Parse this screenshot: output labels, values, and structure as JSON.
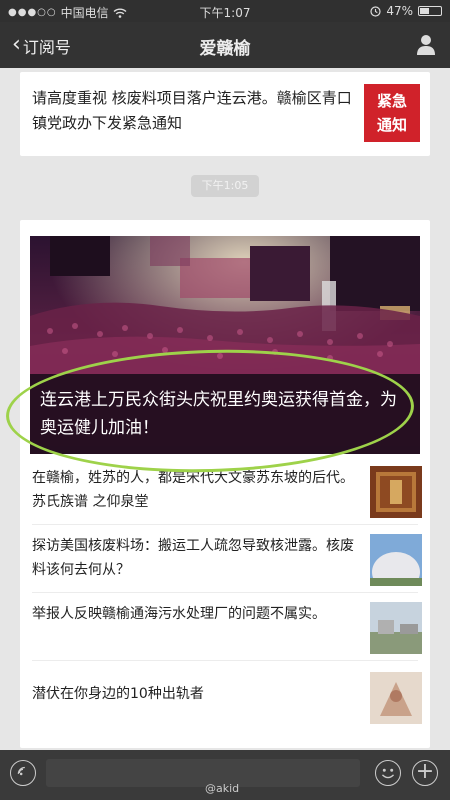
{
  "status_bar": {
    "carrier": "中国电信",
    "time": "下午1:07",
    "battery": "47%",
    "battery_level": 0.47
  },
  "nav": {
    "back_label": "订阅号",
    "title": "爱赣榆"
  },
  "article_top": {
    "text": "请高度重视 核废料项目落户连云港。赣榆区青口镇党政办下发紧急通知",
    "badge_line1": "紧急",
    "badge_line2": "通知"
  },
  "timestamp": "下午1:05",
  "feature": {
    "caption": "连云港上万民众街头庆祝里约奥运获得首金，为奥运健儿加油！"
  },
  "items": [
    {
      "title": "在赣榆，姓苏的人，都是宋代大文豪苏东坡的后代。苏氏族谱 之仰泉堂"
    },
    {
      "title": "探访美国核废料场：搬运工人疏忽导致核泄露。核废料该何去何从？"
    },
    {
      "title": "举报人反映赣榆通海污水处理厂的问题不属实。"
    },
    {
      "title": "潜伏在你身边的10种出轨者"
    }
  ],
  "bottom_bar": {
    "plus_symbol": "+",
    "watermark": "@akid"
  },
  "colors": {
    "urgent_red": "#d0222a",
    "highlight_green": "#9ed24a",
    "header_dark": "#333333"
  }
}
